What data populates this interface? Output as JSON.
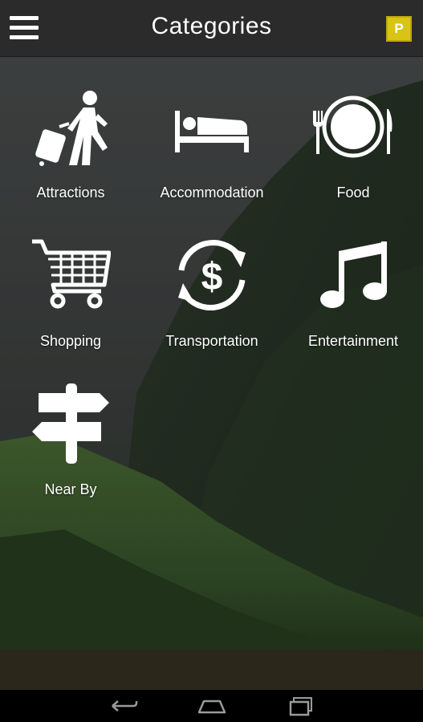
{
  "header": {
    "title": "Categories",
    "badge": "P",
    "menu_icon": "hamburger-menu-icon"
  },
  "categories": [
    {
      "label": "Attractions",
      "icon": "traveler-luggage-icon"
    },
    {
      "label": "Accommodation",
      "icon": "bed-icon"
    },
    {
      "label": "Food",
      "icon": "plate-fork-knife-icon"
    },
    {
      "label": "Shopping",
      "icon": "shopping-cart-icon"
    },
    {
      "label": "Transportation",
      "icon": "currency-exchange-icon"
    },
    {
      "label": "Entertainment",
      "icon": "music-note-icon"
    },
    {
      "label": "Near By",
      "icon": "signpost-icon"
    }
  ],
  "navbar": {
    "buttons": [
      "back",
      "home",
      "recent-apps"
    ]
  },
  "colors": {
    "topbar": "#2b2b2b",
    "badge": "#d8c414",
    "text": "#ffffff"
  }
}
